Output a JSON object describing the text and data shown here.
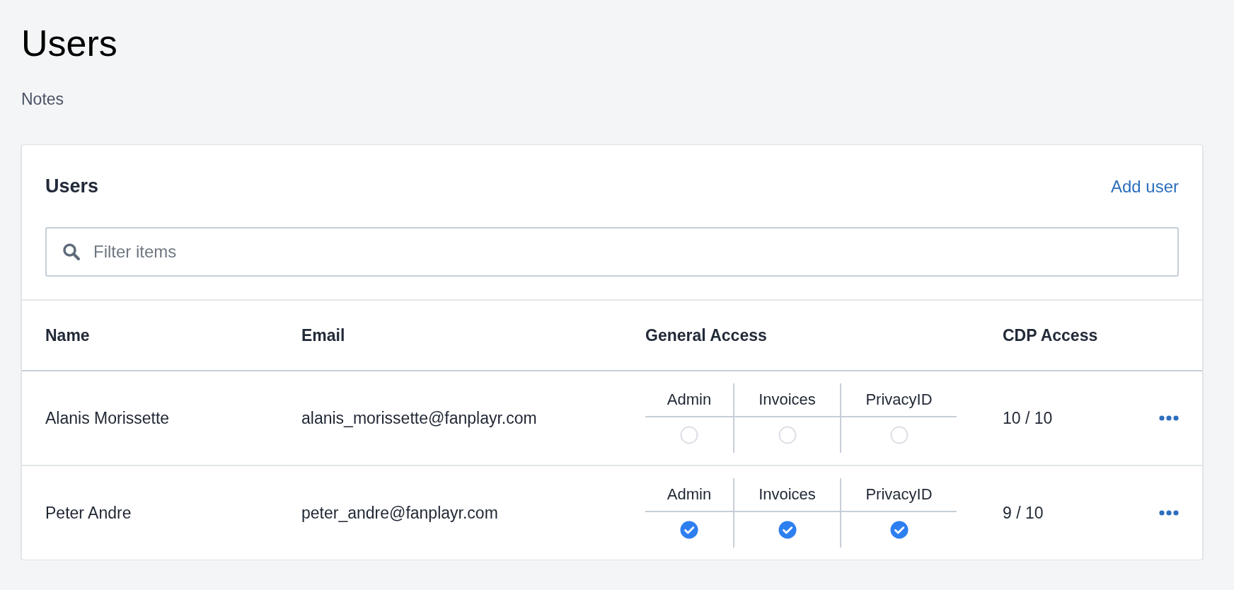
{
  "page": {
    "title": "Users",
    "notes": "Notes"
  },
  "card": {
    "title": "Users",
    "add_link": "Add user",
    "search": {
      "placeholder": "Filter items"
    }
  },
  "table": {
    "columns": [
      "Name",
      "Email",
      "General Access",
      "CDP Access"
    ],
    "rows": [
      {
        "name": "Alanis Morissette",
        "email": "alanis_morissette@fanplayr.com",
        "access": [
          {
            "label": "Admin",
            "checked": false
          },
          {
            "label": "Invoices",
            "checked": false
          },
          {
            "label": "PrivacyID",
            "checked": false
          }
        ],
        "cdp_access": "10 / 10"
      },
      {
        "name": "Peter Andre",
        "email": "peter_andre@fanplayr.com",
        "access": [
          {
            "label": "Admin",
            "checked": true
          },
          {
            "label": "Invoices",
            "checked": true
          },
          {
            "label": "PrivacyID",
            "checked": true
          }
        ],
        "cdp_access": "9 / 10"
      }
    ]
  }
}
